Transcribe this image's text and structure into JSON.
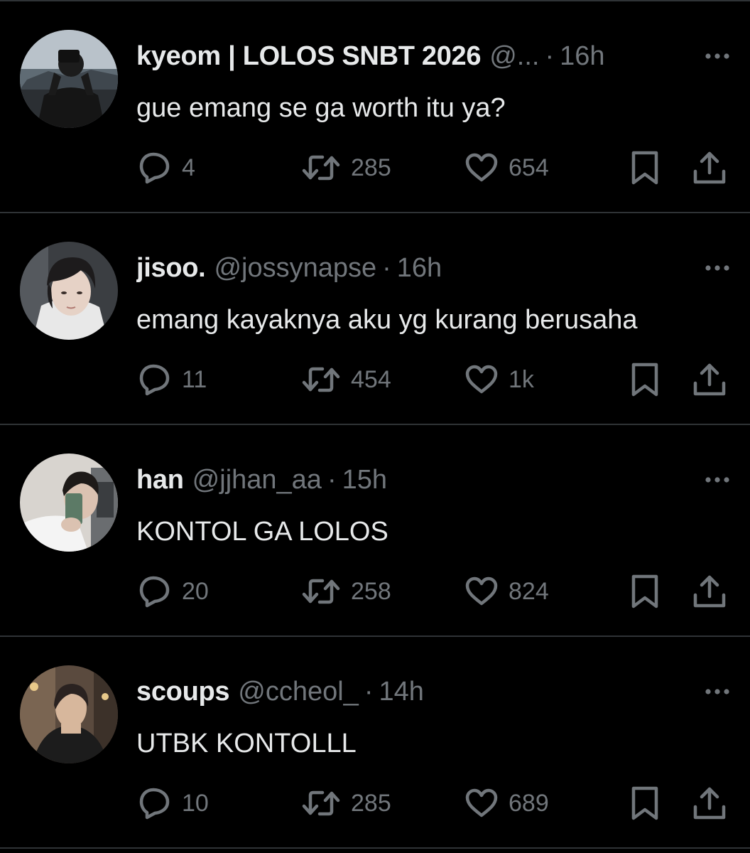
{
  "colors": {
    "background": "#000000",
    "text_primary": "#e7e9ea",
    "text_secondary": "#71767b",
    "divider": "#2f3336"
  },
  "tweets": [
    {
      "display_name": "kyeom | LOLOS SNBT 2026",
      "handle": "@...",
      "separator": "·",
      "time": "16h",
      "text": "gue emang se ga worth itu ya?",
      "replies": "4",
      "retweets": "285",
      "likes": "654",
      "avatar_icon": "profile-photo"
    },
    {
      "display_name": "jisoo.",
      "handle": "@jossynapse",
      "separator": "·",
      "time": "16h",
      "text": "emang kayaknya aku yg kurang berusaha",
      "replies": "11",
      "retweets": "454",
      "likes": "1k",
      "avatar_icon": "profile-photo"
    },
    {
      "display_name": "han",
      "handle": "@jjhan_aa",
      "separator": "·",
      "time": "15h",
      "text": "KONTOL GA LOLOS",
      "replies": "20",
      "retweets": "258",
      "likes": "824",
      "avatar_icon": "profile-photo"
    },
    {
      "display_name": "scoups",
      "handle": "@ccheol_",
      "separator": "·",
      "time": "14h",
      "text": "UTBK KONTOLLL",
      "replies": "10",
      "retweets": "285",
      "likes": "689",
      "avatar_icon": "profile-photo"
    }
  ],
  "icons": {
    "reply": "reply-icon",
    "retweet": "retweet-icon",
    "like": "like-icon",
    "bookmark": "bookmark-icon",
    "share": "share-icon",
    "more": "more-icon"
  }
}
